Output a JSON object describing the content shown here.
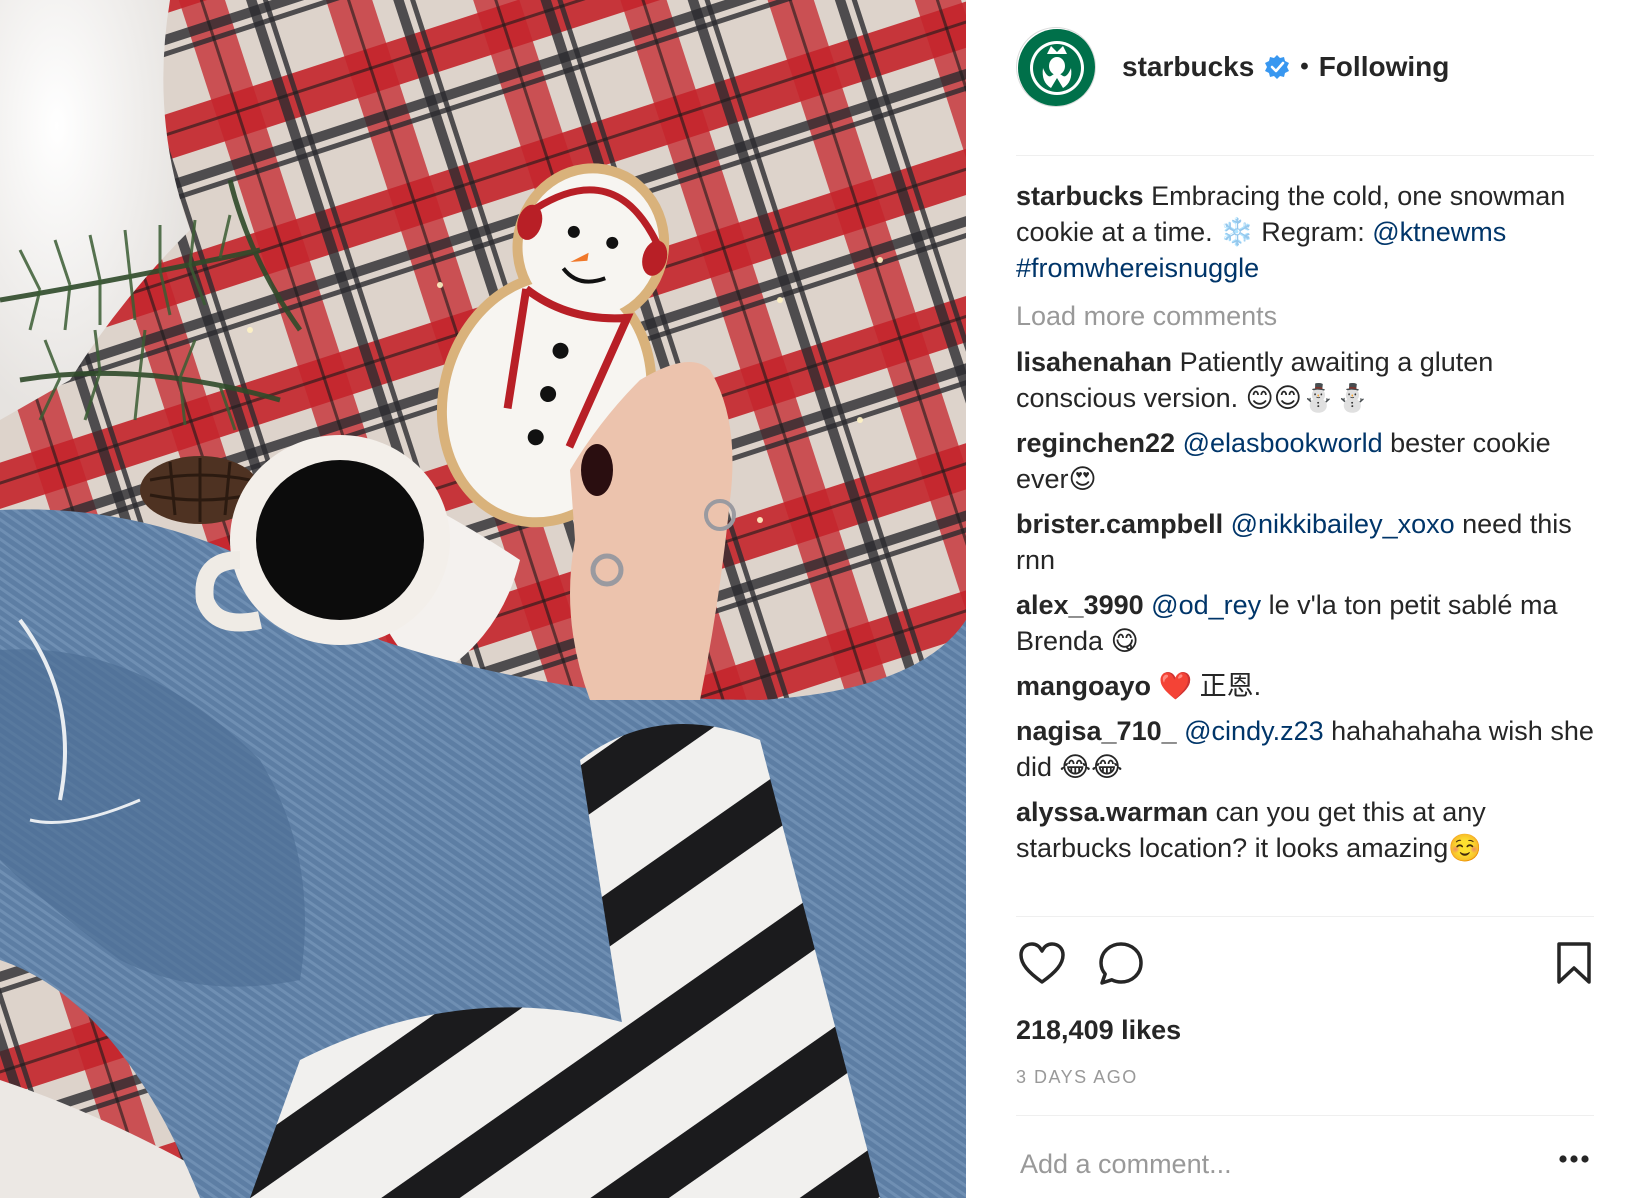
{
  "header": {
    "username": "starbucks",
    "follow_state": "Following",
    "separator": "•",
    "avatar_icon": "starbucks-siren-logo",
    "verified_icon": "verified-badge-icon"
  },
  "caption": {
    "user": "starbucks",
    "text": "Embracing the cold, one snowman cookie at a time. ❄️ Regram:",
    "mention": "@ktnewms",
    "hashtag": "#fromwhereisnuggle"
  },
  "load_more_label": "Load more comments",
  "comments": [
    {
      "user": "lisahenahan",
      "mention": "",
      "text": "Patiently awaiting a gluten conscious version. 😊😊⛄⛄"
    },
    {
      "user": "reginchen22",
      "mention": "@elasbookworld",
      "text": "bester cookie ever😍"
    },
    {
      "user": "brister.campbell",
      "mention": "@nikkibailey_xoxo",
      "text": "need this rnn"
    },
    {
      "user": "alex_3990",
      "mention": "@od_rey",
      "text": "le v'la ton petit sablé ma Brenda 😋"
    },
    {
      "user": "mangoayo",
      "mention": "",
      "text": "❤️ 正恩."
    },
    {
      "user": "nagisa_710_",
      "mention": "@cindy.z23",
      "text": "hahahahaha wish she did 😂😂"
    },
    {
      "user": "alyssa.warman",
      "mention": "",
      "text": "can you get this at any starbucks location? it looks amazing☺️"
    }
  ],
  "actions": {
    "like_icon": "heart-outline-icon",
    "comment_icon": "speech-bubble-icon",
    "save_icon": "bookmark-icon",
    "more_icon": "ellipsis-icon"
  },
  "likes": "218,409 likes",
  "time_ago": "3 DAYS AGO",
  "add_comment_placeholder": "Add a comment...",
  "colors": {
    "text": "#262626",
    "link": "#003569",
    "muted": "#999999",
    "verified": "#3897f0",
    "starbucks_green": "#00704a",
    "divider": "#efefef"
  }
}
